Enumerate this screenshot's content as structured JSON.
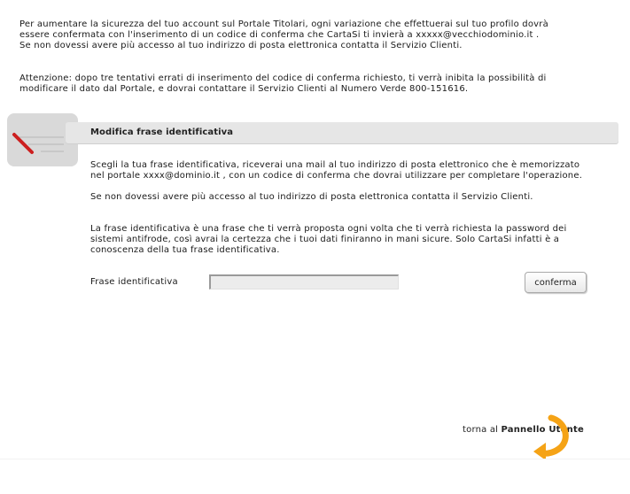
{
  "intro": {
    "line1": "Per aumentare la sicurezza del tuo account sul Portale Titolari, ogni variazione che effettuerai sul tuo profilo dovrà",
    "line2": "essere confermata con l'inserimento di un codice di conferma che CartaSi ti invierà a xxxxx@vecchiodominio.it .",
    "line3": "Se non dovessi avere più accesso al tuo indirizzo di posta elettronica contatta il Servizio Clienti."
  },
  "warning": {
    "line1": "Attenzione: dopo tre tentativi errati di inserimento del codice di conferma richiesto, ti verrà inibita la possibilità di",
    "line2": "modificare il dato dal Portale, e dovrai contattare il Servizio Clienti al Numero Verde 800-151616."
  },
  "section": {
    "title": "Modifica frase identificativa",
    "icon": "pencil-edit-icon",
    "p1_line1": "Scegli la tua frase identificativa, riceverai una mail al tuo indirizzo di posta elettronico che è memorizzato",
    "p1_line2": "nel portale xxxx@dominio.it , con un codice di conferma che dovrai utilizzare per completare l'operazione.",
    "p2": "Se non dovessi avere più accesso al tuo indirizzo di posta elettronica contatta il Servizio Clienti.",
    "p3_line1": "La frase identificativa è una frase che ti verrà proposta ogni volta che ti verrà richiesta la password dei",
    "p3_line2": "sistemi antifrode, così avrai la certezza che i tuoi dati finiranno in mani sicure. Solo CartaSi infatti è a",
    "p3_line3": "conoscenza della tua frase identificativa."
  },
  "form": {
    "label": "Frase identificativa",
    "value": "",
    "placeholder": "",
    "confirm_label": "conferma"
  },
  "footer": {
    "back_prefix": "torna al",
    "back_target": "Pannello Utente",
    "arrow_icon": "orange-return-arrow-icon",
    "arrow_color": "#f5a316"
  }
}
